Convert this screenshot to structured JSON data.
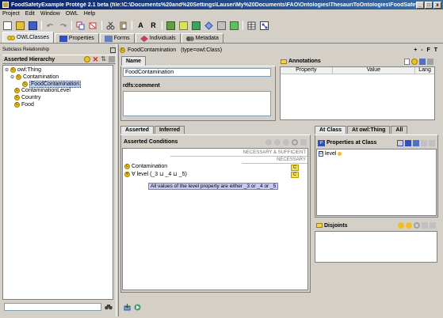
{
  "window": {
    "title": "FoodSafetyExample Protégé 2.1 beta  (file:\\C:\\Documents%20and%20Settings\\Lauser\\My%20Documents\\FAO\\Ontologies\\ThesauriToOntologies\\FoodSafetyExa...",
    "min": "_",
    "max": "□",
    "close": "x"
  },
  "menu": [
    "Project",
    "Edit",
    "Window",
    "OWL",
    "Help"
  ],
  "toolbar": {
    "a_label": "A",
    "r_label": "R"
  },
  "main_tabs": [
    {
      "label": "OWLClasses",
      "color": "#e8a020"
    },
    {
      "label": "Properties",
      "color": "#3050c0"
    },
    {
      "label": "Forms",
      "color": "#6080c0"
    },
    {
      "label": "Individuals",
      "color": "#c04060"
    },
    {
      "label": "Metadata",
      "color": "#505050"
    }
  ],
  "left": {
    "subclass_label": "Subclass Relationship",
    "hierarchy_title": "Asserted Hierarchy",
    "tree": [
      {
        "label": "owl:Thing"
      },
      {
        "label": "Contamination"
      },
      {
        "label": "FoodContamination"
      },
      {
        "label": "ContaminationLevel"
      },
      {
        "label": "Country"
      },
      {
        "label": "Food"
      }
    ]
  },
  "class_header": {
    "name": "FoodContamination",
    "type": "(type=owl:Class)",
    "controls": "+ - F T"
  },
  "name_tab": "Name",
  "name_value": "FoodContamination",
  "rdfs_comment": "rdfs:comment",
  "annotations": {
    "title": "Annotations",
    "cols": [
      "Property",
      "Value",
      "Lang"
    ]
  },
  "cond_tabs": [
    "Asserted",
    "Inferred"
  ],
  "conditions": {
    "title": "Asserted Conditions",
    "nec_suff": "NECESSARY & SUFFICIENT",
    "nec": "NECESSARY",
    "rows": [
      {
        "text": "Contamination",
        "badge": "C"
      },
      {
        "text": "∀ level (_3 ⊔ _4 ⊔ _5)",
        "badge": "C"
      }
    ],
    "tooltip": "All values of the level property are either _3 or _4 or _5"
  },
  "right_tabs": [
    "At Class",
    "At owl:Thing",
    "All"
  ],
  "props_at_class": {
    "title": "Properties at Class",
    "items": [
      {
        "label": "level"
      }
    ]
  },
  "disjoints": {
    "title": "Disjoints"
  },
  "search": {
    "value": ""
  }
}
